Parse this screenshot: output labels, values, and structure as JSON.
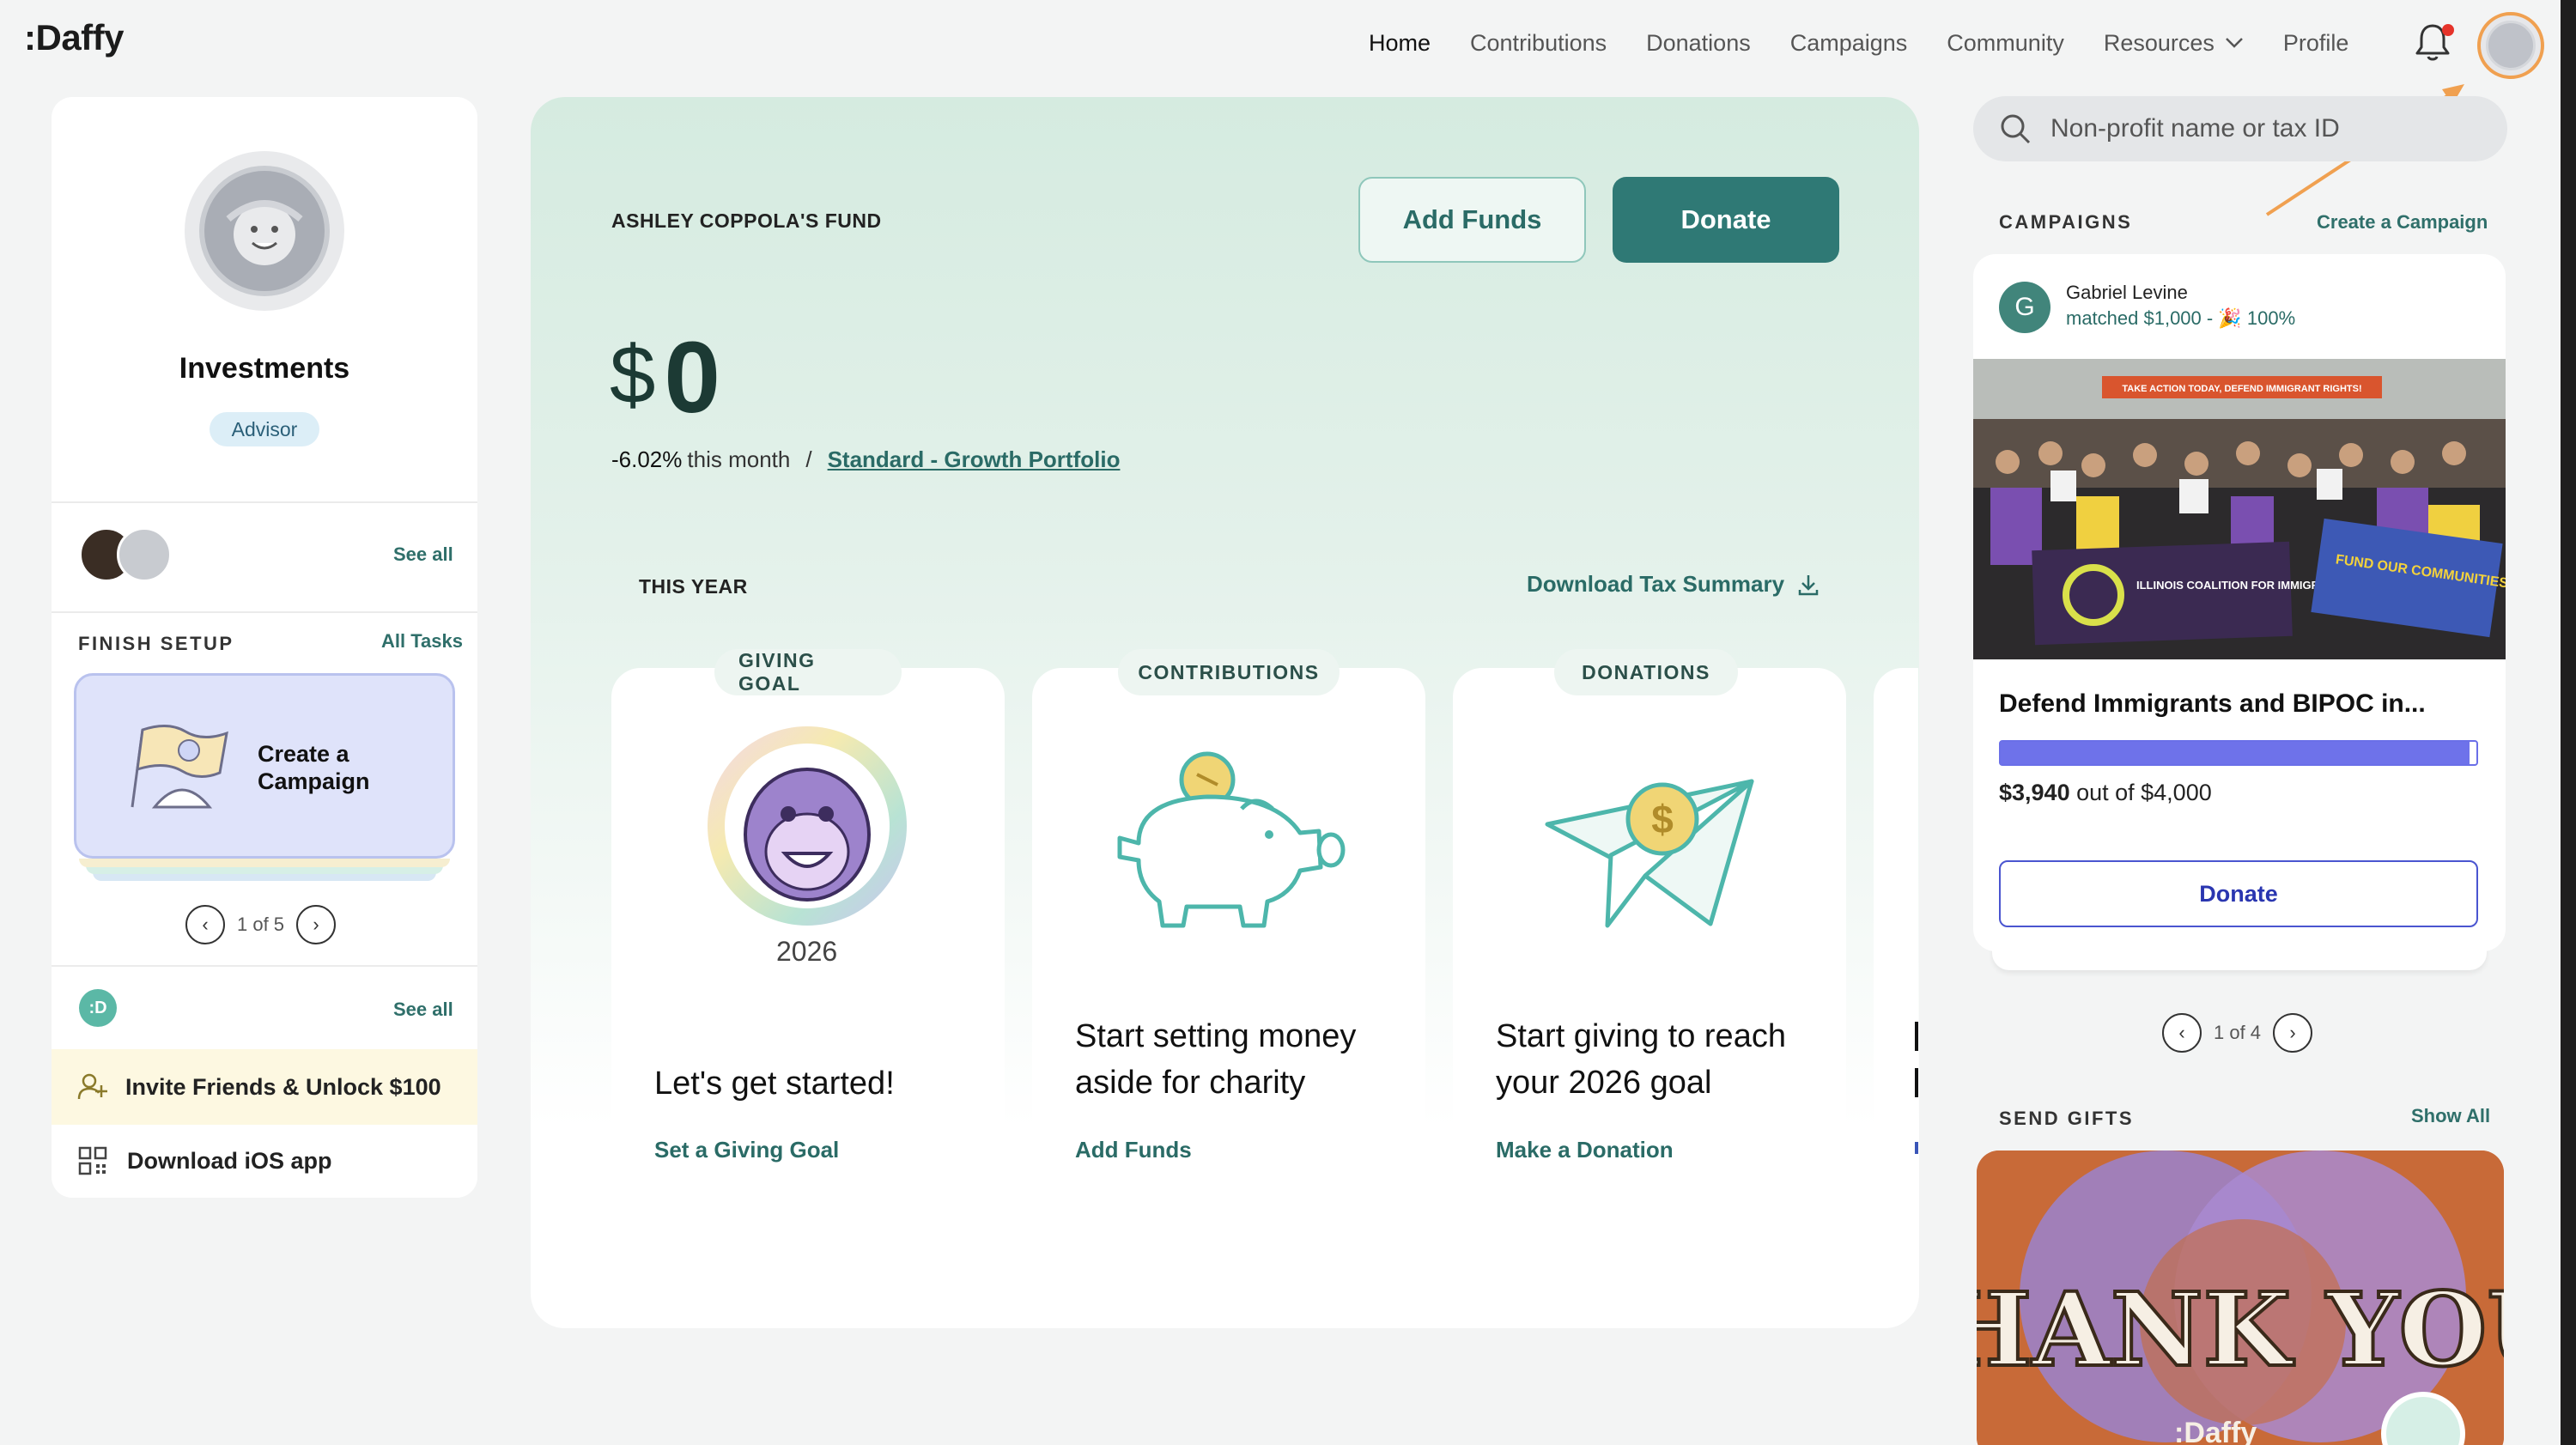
{
  "brand": {
    "logo_text": ":Daffy"
  },
  "nav": {
    "items": [
      {
        "label": "Home",
        "active": true
      },
      {
        "label": "Contributions"
      },
      {
        "label": "Donations"
      },
      {
        "label": "Campaigns"
      },
      {
        "label": "Community"
      },
      {
        "label": "Resources",
        "dropdown": true
      },
      {
        "label": "Profile"
      }
    ],
    "icons": {
      "bell": "bell-icon",
      "avatar": "user-avatar"
    }
  },
  "sidebar": {
    "profile_name": "Investments",
    "role_badge": "Advisor",
    "members_see_all": "See all",
    "finish_setup_label": "FINISH SETUP",
    "all_tasks": "All Tasks",
    "setup_card_title": "Create a Campaign",
    "setup_pager": "1 of 5",
    "daffy_see_all": "See all",
    "daffy_logo": ":D",
    "invite_label": "Invite Friends & Unlock $100",
    "ios_label": "Download iOS app"
  },
  "fund": {
    "name": "ASHLEY COPPOLA'S FUND",
    "add_funds": "Add Funds",
    "donate": "Donate",
    "currency": "$",
    "balance": "0",
    "change": "-6.02%",
    "change_suffix": "this month",
    "separator": "/",
    "portfolio": "Standard - Growth Portfolio",
    "this_year": "THIS YEAR",
    "tax_summary": "Download Tax Summary"
  },
  "cards": [
    {
      "tag": "GIVING GOAL",
      "year": "2026",
      "heading": "Let's get started!",
      "link": "Set a Giving Goal"
    },
    {
      "tag": "CONTRIBUTIONS",
      "heading": "Start setting money aside for charity",
      "link": "Add Funds"
    },
    {
      "tag": "DONATIONS",
      "heading": "Start giving to reach your 2026 goal",
      "link": "Make a Donation"
    }
  ],
  "right": {
    "search_placeholder": "Non-profit name or tax ID",
    "campaigns_label": "CAMPAIGNS",
    "create_campaign": "Create a Campaign",
    "campaign": {
      "avatar_letter": "G",
      "user": "Gabriel Levine",
      "match_text": "matched $1,000 - ",
      "match_emoji": "🎉",
      "match_pct": "100%",
      "photo_banner": "TAKE ACTION TODAY, DEFEND IMMIGRANT RIGHTS!",
      "sign_left": "ILLINOIS COALITION FOR IMMIGRANT & REFUGEE RIGHTS",
      "sign_right": "FUND OUR COMMUNITIES Tax Billionaires",
      "title": "Defend Immigrants and BIPOC in...",
      "raised": "$3,940",
      "raised_suffix": " out of $4,000",
      "progress_fraction": 0.985,
      "donate": "Donate"
    },
    "campaign_pager": "1 of 4",
    "send_gifts_label": "SEND GIFTS",
    "show_all": "Show All",
    "gift_text": "THANK YOU!",
    "gift_brand": ":Daffy"
  },
  "colors": {
    "accent": "#2f7975",
    "progress": "#6e72ea",
    "highlight": "#f0a050"
  }
}
